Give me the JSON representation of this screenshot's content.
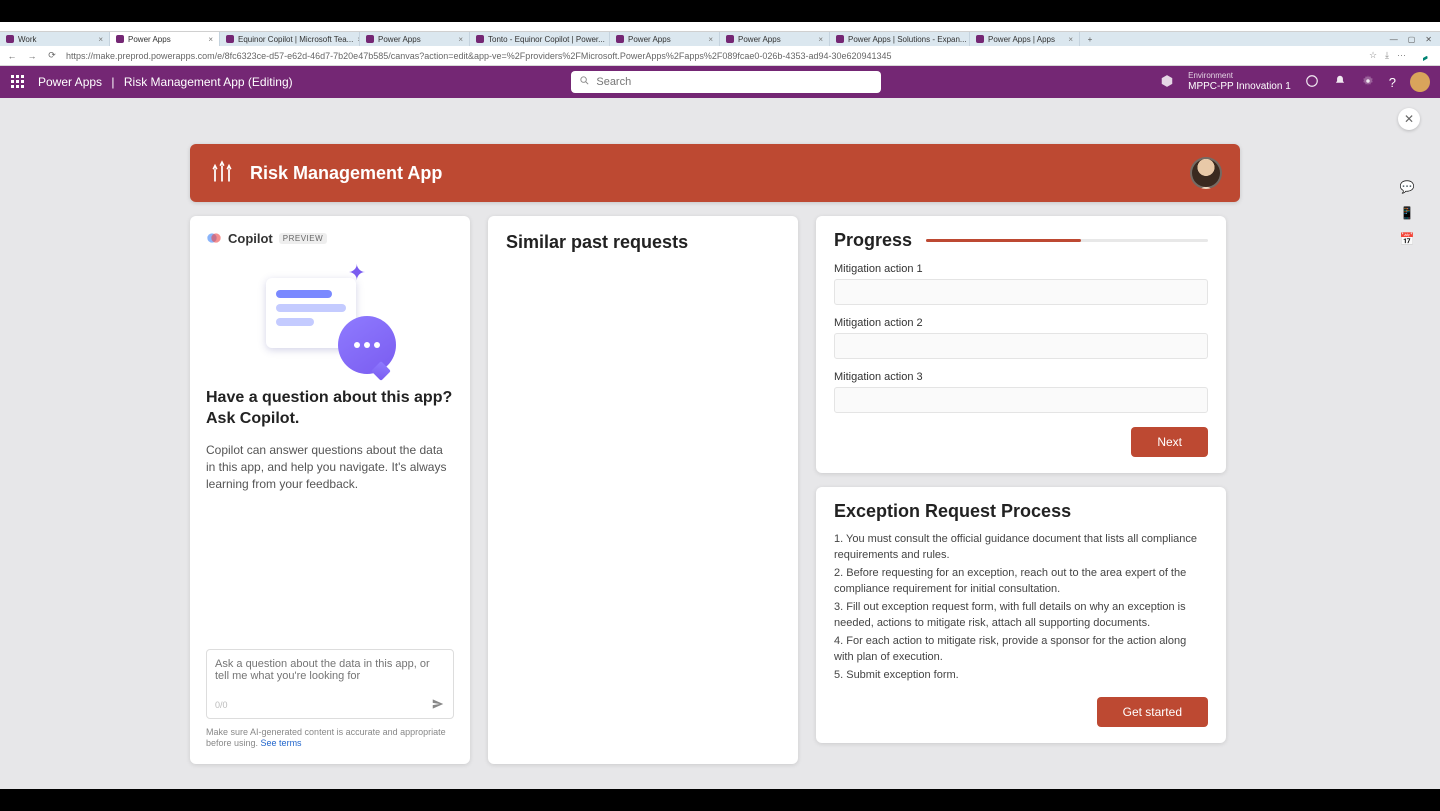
{
  "browser": {
    "tabs": [
      {
        "label": "Work"
      },
      {
        "label": "Power Apps",
        "active": true
      },
      {
        "label": "Equinor Copilot | Microsoft Tea..."
      },
      {
        "label": "Power Apps"
      },
      {
        "label": "Tonto - Equinor Copilot | Power..."
      },
      {
        "label": "Power Apps"
      },
      {
        "label": "Power Apps"
      },
      {
        "label": "Power Apps | Solutions - Expan..."
      },
      {
        "label": "Power Apps | Apps"
      }
    ],
    "new_tab": "+",
    "nav": {
      "back": "←",
      "forward": "→",
      "refresh": "⟳"
    },
    "url": "https://make.preprod.powerapps.com/e/8fc6323ce-d57-e62d-46d7-7b20e47b585/canvas?action=edit&app-ve=%2Fproviders%2FMicrosoft.PowerApps%2Fapps%2F089fcae0-026b-4353-ad94-30e620941345",
    "win_controls": {
      "min": "—",
      "max": "▢",
      "close": "✕"
    }
  },
  "header": {
    "product": "Power Apps",
    "separator": "|",
    "page": "Risk Management App (Editing)",
    "search_placeholder": "Search",
    "env_label": "Environment",
    "env_value": "MPPC-PP Innovation 1"
  },
  "sidebar_icons": [
    "chat-icon",
    "phone-icon",
    "calendar-icon"
  ],
  "app": {
    "title": "Risk Management App",
    "copilot": {
      "name": "Copilot",
      "badge": "PREVIEW",
      "heading": "Have a question about this app? Ask Copilot.",
      "description": "Copilot can answer questions about the data in this app, and help you navigate. It's always learning from your feedback.",
      "placeholder": "Ask a question about the data in this app, or tell me what you're looking for",
      "char_count": "0/0",
      "disclaimer_pre": "Make sure AI-generated content is accurate and appropriate before using. ",
      "disclaimer_link": "See terms"
    },
    "similar": {
      "heading": "Similar past requests"
    },
    "progress": {
      "heading": "Progress",
      "percent": 55,
      "fields": [
        {
          "label": "Mitigation action 1",
          "value": ""
        },
        {
          "label": "Mitigation action 2",
          "value": ""
        },
        {
          "label": "Mitigation action 3",
          "value": ""
        }
      ],
      "next": "Next"
    },
    "process": {
      "heading": "Exception Request Process",
      "steps": [
        "1. You must consult the official guidance document that lists all compliance requirements and rules.",
        "2. Before requesting for an exception, reach out to the area expert of the compliance requirement for initial consultation.",
        "3. Fill out exception request form, with full details on why an exception is needed, actions to mitigate risk, attach all supporting documents.",
        "4. For each action to mitigate risk, provide a sponsor for the action along with plan of execution.",
        "5. Submit exception form."
      ],
      "cta": "Get started"
    }
  }
}
